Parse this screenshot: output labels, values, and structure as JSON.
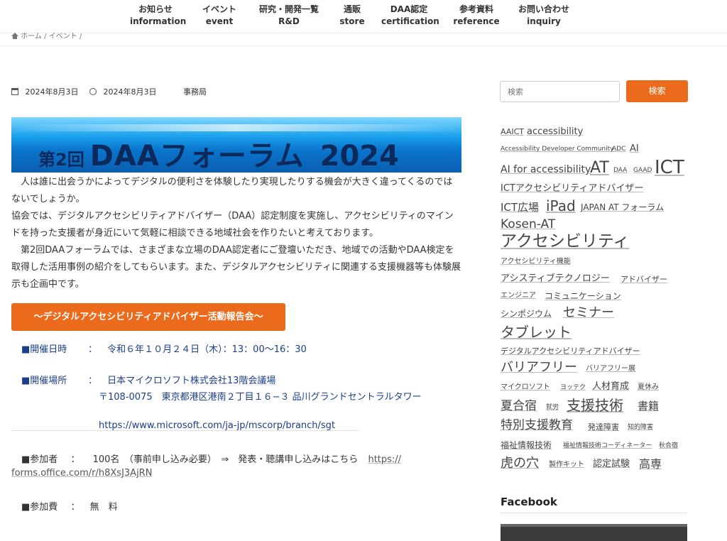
{
  "nav": [
    {
      "ja": "お知らせ",
      "en": "information"
    },
    {
      "ja": "イベント",
      "en": "event"
    },
    {
      "ja": "研究・開発一覧",
      "en": "R&D"
    },
    {
      "ja": "通販",
      "en": "store"
    },
    {
      "ja": "DAA認定",
      "en": "certification"
    },
    {
      "ja": "参考資料",
      "en": "reference"
    },
    {
      "ja": "お問い合わせ",
      "en": "inquiry"
    }
  ],
  "breadcrumb": {
    "home": "ホーム",
    "sep": "/",
    "event": "イベント"
  },
  "post": {
    "published": "2024年8月3日",
    "updated": "2024年8月3日",
    "author": "事務局",
    "banner": {
      "prefix": "第2回",
      "title": "DAAフォーラム",
      "year": "2024"
    },
    "paragraphs": [
      "　人は誰に出会うかによってデジタルの便利さを体験したり実現したりする機会が大きく違ってくるのではないでしょうか。",
      "協会では、デジタルアクセシビリティアドバイザー（DAA）認定制度を実施し、アクセシビリティのマインドを持った支援者が身近にいて気軽に相談できる地域社会を作りたいと考えております。",
      "　第2回DAAフォーラムでは、さまざまな立場のDAA認定者にご登壇いただき、地域での活動やDAA検定を取得した活用事例の紹介をしてもらいます。また、デジタルアクセシビリティに関連する支援機器等も体験展示も企画中です。"
    ],
    "report_button": "～デジタルアクセシビリティアドバイザー活動報告会～",
    "date_label": "■開催日時",
    "colon": "：",
    "date_value": "令和６年１０月２４日（木）：13：00～16：30",
    "place_label": "■開催場所",
    "place_name": "日本マイクロソフト株式会社13階会議場",
    "place_address": "〒108-0075　東京都港区港南２丁目１６−３ 品川グランドセントラルタワー",
    "place_url": "https://www.microsoft.com/ja-jp/mscorp/branch/sgt",
    "participants_label": "■参加者",
    "participants_value": "100名　（事前申し込み必要）　⇒　発表・聴講申し込みはこちら",
    "form_url_1": "https://",
    "form_url_2": "forms.office.com/r/h8XsJ3AjRN",
    "fee_label": "■参加費",
    "fee_value": "無　料"
  },
  "sidebar": {
    "search_placeholder": "検索",
    "search_button": "検索",
    "tags": [
      "AAICT",
      "accessibility",
      "Accessibility Developer Community",
      "ADC",
      "AI",
      "AI for accessibility",
      "AT",
      "DAA",
      "GAAD",
      "ICT",
      "ICTアクセシビリティアドバイザー",
      "ICT広場",
      "iPad",
      "JAPAN AT フォーラム",
      "Kosen-AT",
      "アクセシビリティ",
      "アクセシビリティ機能",
      "アシスティブテクノロジー",
      "アドバイザー",
      "エンジニア",
      "コミュニケーション",
      "シンポジウム",
      "セミナー",
      "タブレット",
      "デジタルアクセシビリティアドバイザー",
      "バリアフリー",
      "バリアフリー展",
      "マイクロソフト",
      "ヨッテク",
      "人材育成",
      "夏休み",
      "夏合宿",
      "就労",
      "支援技術",
      "書籍",
      "特別支援教育",
      "発達障害",
      "知的障害",
      "福祉情報技術",
      "福祉情報技術コーディネーター",
      "秋合宿",
      "虎の穴",
      "製作キット",
      "認定試験",
      "高専"
    ],
    "facebook_title": "Facebook"
  }
}
